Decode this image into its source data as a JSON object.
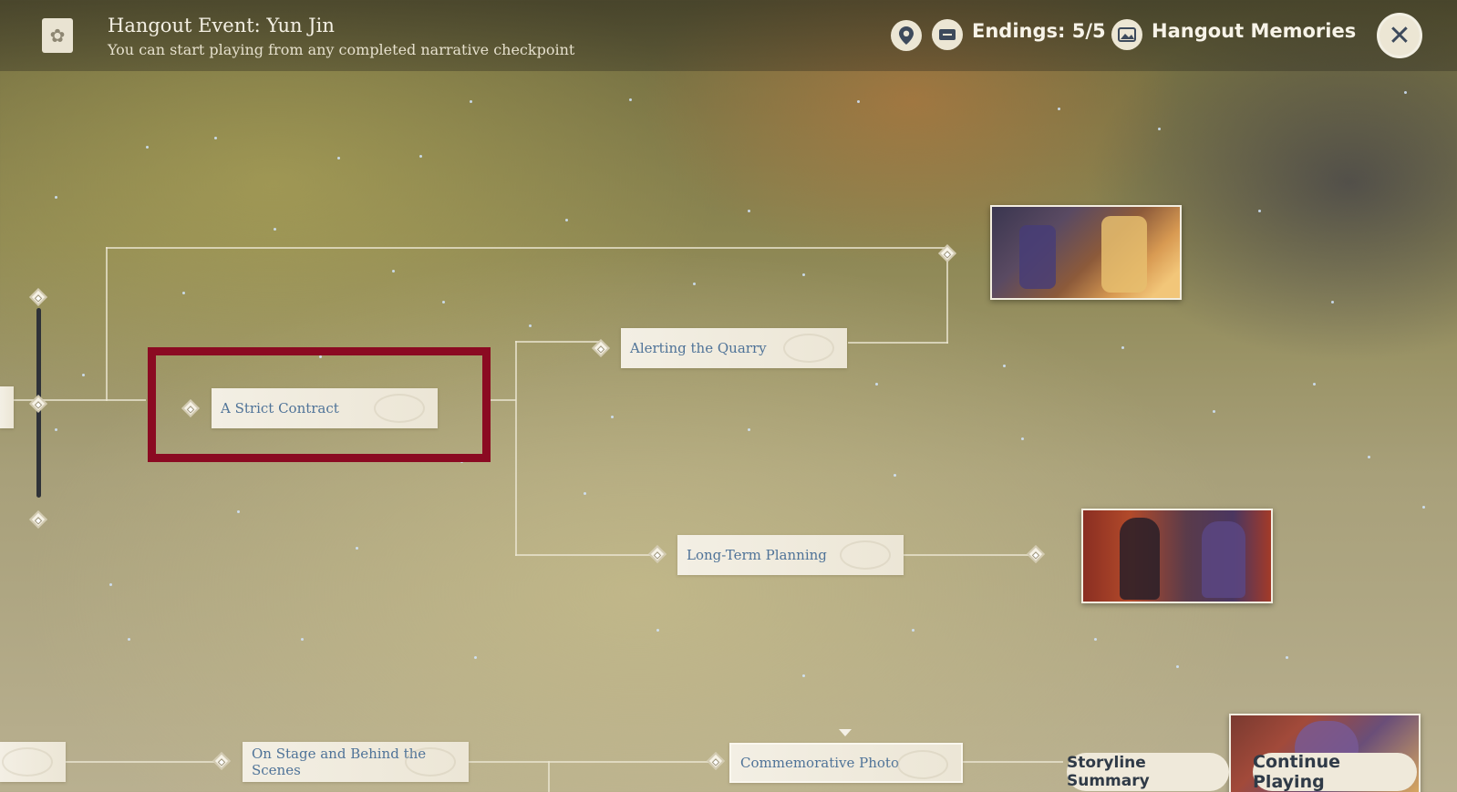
{
  "header": {
    "title": "Hangout Event: Yun Jin",
    "subtitle": "You can start playing from any completed narrative checkpoint",
    "endings_label": "Endings: 5/5",
    "memories_label": "Hangout Memories",
    "icons": {
      "event": "scroll-icon",
      "location": "map-pin-icon",
      "endings": "endings-icon",
      "memories": "photo-icon",
      "close": "close-icon"
    }
  },
  "nodes": {
    "strict_contract": "A Strict Contract",
    "alerting_quarry": "Alerting the Quarry",
    "long_term_planning": "Long-Term Planning",
    "on_stage": "On Stage and Behind the Scenes",
    "commemorative_photo": "Commemorative Photo"
  },
  "buttons": {
    "storyline_summary": "Storyline Summary",
    "continue_playing": "Continue Playing"
  },
  "colors": {
    "highlight": "#8b0a22",
    "node_text": "#4f7398",
    "node_bg": "#f3efe4"
  }
}
